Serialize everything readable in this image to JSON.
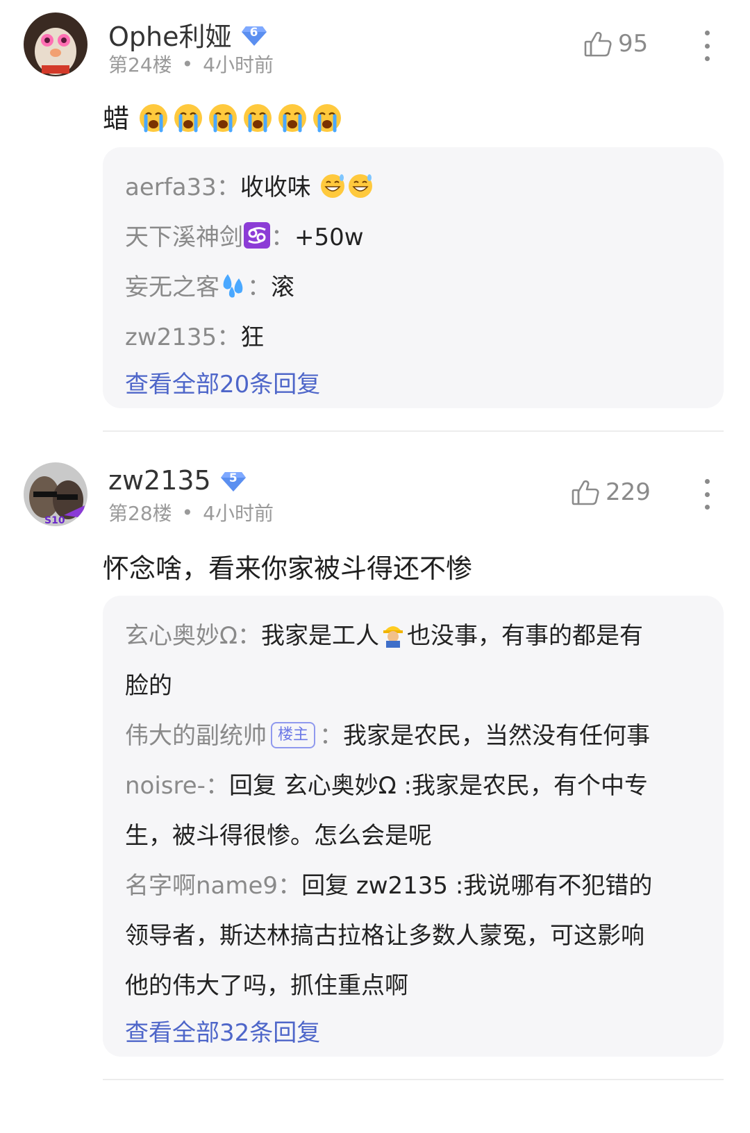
{
  "comments": [
    {
      "username": "Ophe利娅",
      "level": "6",
      "floor": "第24楼",
      "dot": "•",
      "time": "4小时前",
      "likes": "95",
      "text": "蜡",
      "emojis": [
        "crying-face-emoji",
        "crying-face-emoji",
        "crying-face-emoji",
        "crying-face-emoji",
        "crying-face-emoji",
        "crying-face-emoji"
      ],
      "replies": [
        {
          "user": "aerfa33",
          "sep": "：",
          "text": "收收味"
        },
        {
          "user": "天下溪神剑",
          "sep": "：",
          "text": "+50w"
        },
        {
          "user": "妄无之客",
          "sep": "：",
          "text": "滚"
        },
        {
          "user": "zw2135",
          "sep": "：",
          "text": "狂"
        }
      ],
      "view_all": "查看全部20条回复"
    },
    {
      "username": "zw2135",
      "level": "5",
      "floor": "第28楼",
      "dot": "•",
      "time": "4小时前",
      "likes": "229",
      "text": "怀念啥，看来你家被斗得还不惨",
      "replies": [
        {
          "user": "玄心奥妙Ω",
          "sep": "：",
          "text": "我家是工人",
          "text2": "也没事，有事的都是有",
          "text3": "脸的"
        },
        {
          "user": "伟大的副统帅",
          "tag": "楼主",
          "sep": "：",
          "text": "我家是农民，当然没有任何事"
        },
        {
          "user": "noisre-",
          "sep": "：",
          "text": "回复 玄心奥妙Ω :我家是农民，有个中专",
          "text2": "生，被斗得很惨。怎么会是呢"
        },
        {
          "user": "名字啊name9",
          "sep": "：",
          "text": "回复 zw2135 :我说哪有不犯错的",
          "text2": "领导者，斯达林搞古拉格让多数人蒙冤，可这影响",
          "text3": "他的伟大了吗，抓住重点啊"
        }
      ],
      "view_all": "查看全部32条回复"
    }
  ],
  "colors": {
    "link": "#4e66c9",
    "muted": "#9a9a9a",
    "reply_bg": "#f6f6f8",
    "badge": "#5b8ff0"
  }
}
